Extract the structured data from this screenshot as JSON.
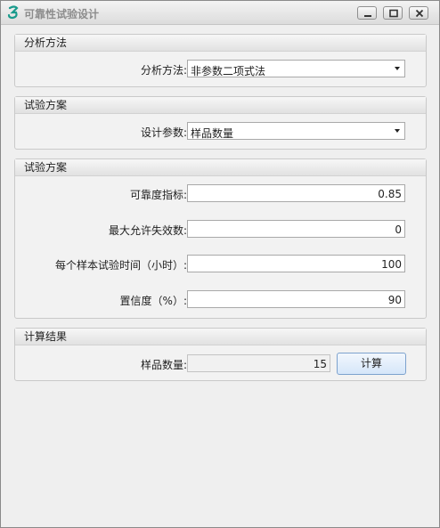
{
  "window": {
    "title": "可靠性试验设计",
    "icon": "app-logo-icon",
    "accent": "#1a9b8c"
  },
  "analysis_group": {
    "title": "分析方法",
    "method_label": "分析方法:",
    "method_value": "非参数二项式法"
  },
  "plan_group": {
    "title": "试验方案",
    "param_label": "设计参数:",
    "param_value": "样品数量"
  },
  "params_group": {
    "title": "试验方案",
    "fields": [
      {
        "label": "可靠度指标:",
        "value": "0.85"
      },
      {
        "label": "最大允许失效数:",
        "value": "0"
      },
      {
        "label": "每个样本试验时间（小时）:",
        "value": "100"
      },
      {
        "label": "置信度（%）:",
        "value": "90"
      }
    ]
  },
  "result_group": {
    "title": "计算结果",
    "result_label": "样品数量:",
    "result_value": "15",
    "calc_button": "计算"
  }
}
